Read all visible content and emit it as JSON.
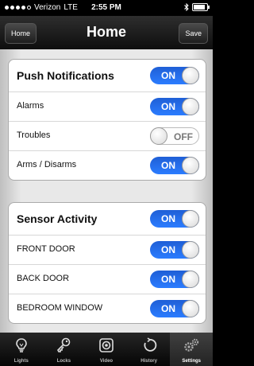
{
  "statusbar": {
    "carrier": "Verizon",
    "network": "LTE",
    "time": "2:55 PM"
  },
  "navbar": {
    "title": "Home",
    "left_button": "Home",
    "right_button": "Save"
  },
  "push_group": {
    "header": {
      "label": "Push Notifications",
      "state": "ON"
    },
    "rows": [
      {
        "label": "Alarms",
        "state": "ON"
      },
      {
        "label": "Troubles",
        "state": "OFF"
      },
      {
        "label": "Arms / Disarms",
        "state": "ON"
      }
    ]
  },
  "sensor_group": {
    "header": {
      "label": "Sensor Activity",
      "state": "ON"
    },
    "rows": [
      {
        "label": "FRONT DOOR",
        "state": "ON"
      },
      {
        "label": "BACK DOOR",
        "state": "ON"
      },
      {
        "label": "BEDROOM WINDOW",
        "state": "ON"
      }
    ]
  },
  "tabs": [
    {
      "label": "Lights",
      "icon": "lightbulb-icon"
    },
    {
      "label": "Locks",
      "icon": "key-icon"
    },
    {
      "label": "Video",
      "icon": "camera-icon"
    },
    {
      "label": "History",
      "icon": "history-icon"
    },
    {
      "label": "Settings",
      "icon": "gears-icon",
      "active": true
    }
  ],
  "colors": {
    "toggle_on": "#2b7cff",
    "toggle_off": "#fdfdfd"
  }
}
